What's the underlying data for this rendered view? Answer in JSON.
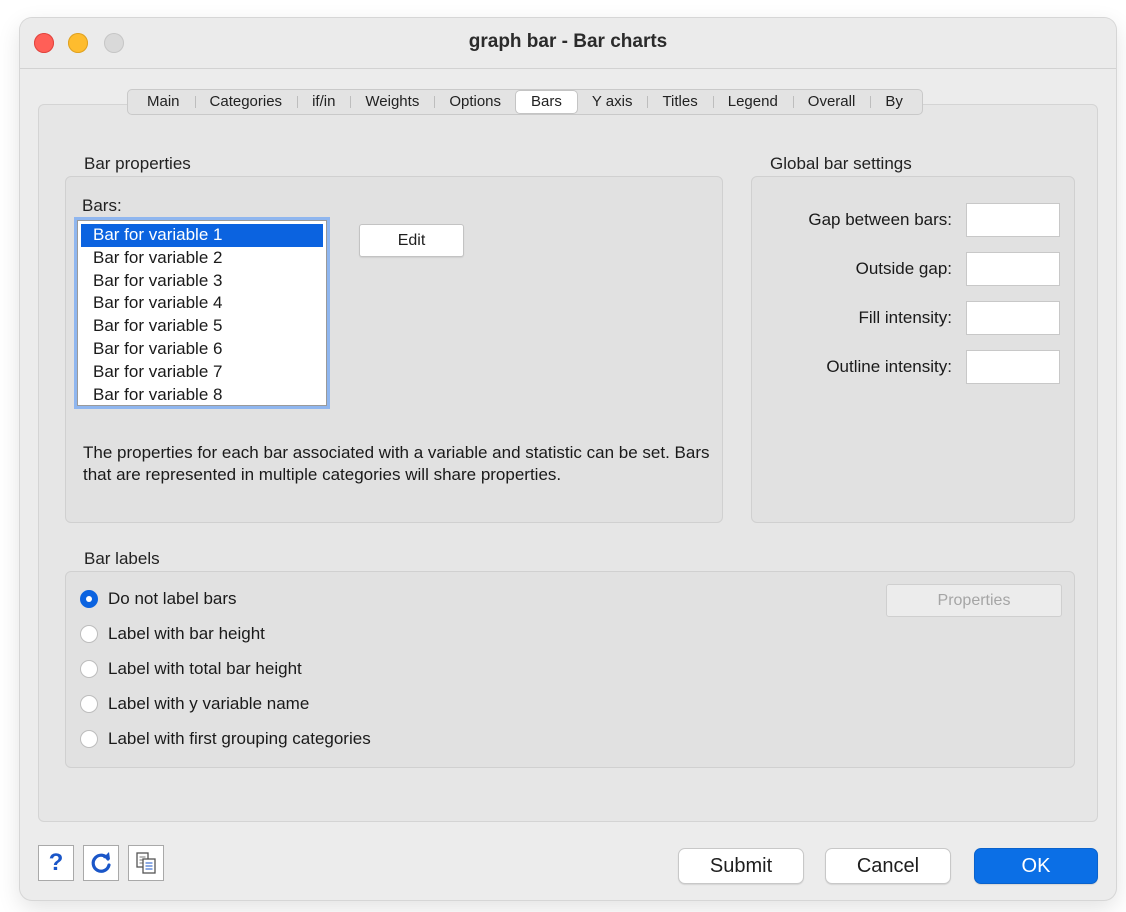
{
  "window": {
    "title": "graph bar - Bar charts"
  },
  "tabs": [
    "Main",
    "Categories",
    "if/in",
    "Weights",
    "Options",
    "Bars",
    "Y axis",
    "Titles",
    "Legend",
    "Overall",
    "By"
  ],
  "active_tab": "Bars",
  "bar_properties": {
    "section_label": "Bar properties",
    "bars_label": "Bars:",
    "items": [
      "Bar for variable 1",
      "Bar for variable 2",
      "Bar for variable 3",
      "Bar for variable 4",
      "Bar for variable 5",
      "Bar for variable 6",
      "Bar for variable 7",
      "Bar for variable 8"
    ],
    "selected_index": 0,
    "edit_label": "Edit",
    "help_text": "The properties for each bar associated with a variable and statistic can be set. Bars that are represented in multiple categories will share properties."
  },
  "global_bar_settings": {
    "section_label": "Global bar settings",
    "gap_between_bars": {
      "label": "Gap between bars:",
      "value": ""
    },
    "outside_gap": {
      "label": "Outside gap:",
      "value": ""
    },
    "fill_intensity": {
      "label": "Fill intensity:",
      "value": ""
    },
    "outline_intensity": {
      "label": "Outline intensity:",
      "value": ""
    }
  },
  "bar_labels": {
    "section_label": "Bar labels",
    "options": [
      "Do not label bars",
      "Label with bar height",
      "Label with total bar height",
      "Label with y variable name",
      "Label with first grouping categories"
    ],
    "selected_index": 0,
    "properties_label": "Properties"
  },
  "footer": {
    "help_icon": "?",
    "reset_icon": "reset-icon",
    "copy_icon": "copy-icon",
    "submit_label": "Submit",
    "cancel_label": "Cancel",
    "ok_label": "OK"
  },
  "colors": {
    "accent": "#0b63e0",
    "ok_button": "#0b6fe6"
  }
}
